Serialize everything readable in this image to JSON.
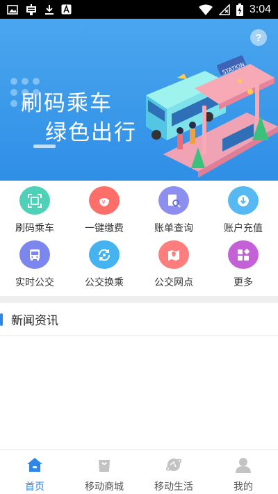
{
  "status_bar": {
    "time": "3:04",
    "left_icons": [
      "image-icon",
      "ghost-app-icon",
      "download-icon",
      "font-app-icon"
    ],
    "right_icons": [
      "wifi-icon",
      "no-signal-icon",
      "battery-charging-icon"
    ]
  },
  "banner": {
    "title_line1": "刷码乘车",
    "title_line2": "绿色出行",
    "sign_text": "STATION",
    "help_label": "?",
    "background_color": "#3a9aec"
  },
  "services": [
    {
      "label": "刷码乘车",
      "icon": "qr-scan-icon",
      "color": "#4fd1b8"
    },
    {
      "label": "一键缴费",
      "icon": "payment-icon",
      "color": "#ff6f6a"
    },
    {
      "label": "账单查询",
      "icon": "bill-search-icon",
      "color": "#8c8ef0"
    },
    {
      "label": "账户充值",
      "icon": "recharge-icon",
      "color": "#57b9f4"
    },
    {
      "label": "实时公交",
      "icon": "bus-icon",
      "color": "#7c86ef"
    },
    {
      "label": "公交换乘",
      "icon": "transfer-icon",
      "color": "#45b3f0"
    },
    {
      "label": "公交网点",
      "icon": "map-pin-icon",
      "color": "#ff7d7d"
    },
    {
      "label": "更多",
      "icon": "more-apps-icon",
      "color": "#c561d6"
    }
  ],
  "news": {
    "title": "新闻资讯",
    "accent_color": "#2f86e8"
  },
  "bottom_nav": {
    "active_index": 0,
    "items": [
      {
        "label": "首页",
        "icon": "home-icon"
      },
      {
        "label": "移动商城",
        "icon": "shopping-bag-icon"
      },
      {
        "label": "移动生活",
        "icon": "planet-icon"
      },
      {
        "label": "我的",
        "icon": "user-icon"
      }
    ]
  }
}
